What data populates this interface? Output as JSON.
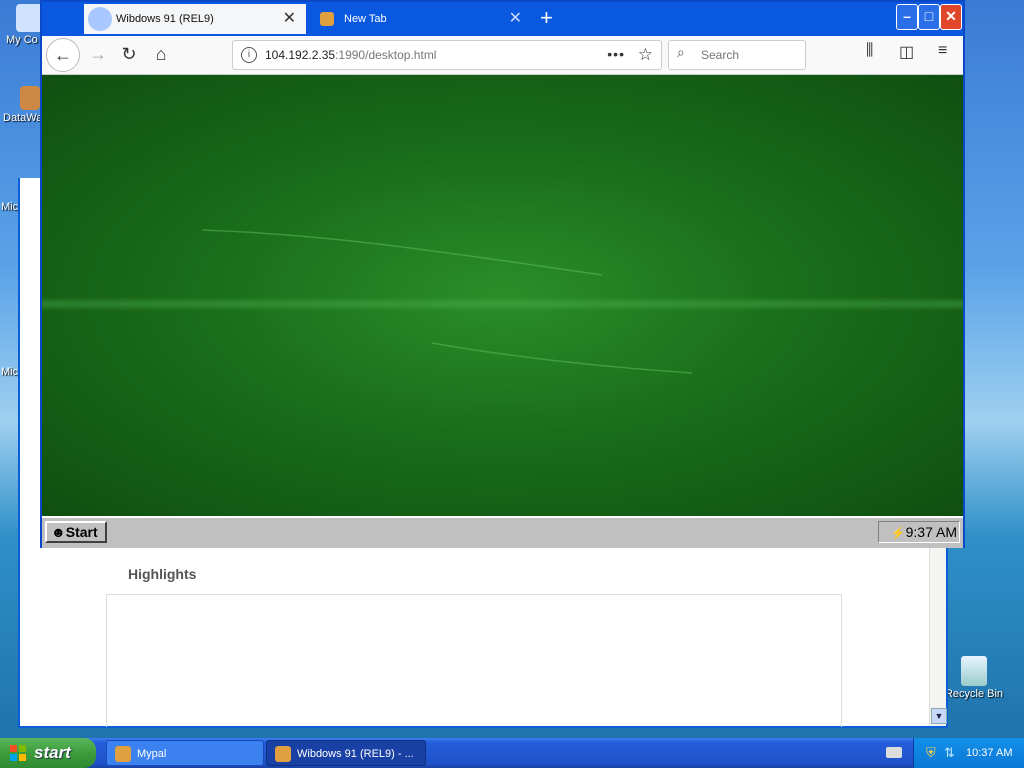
{
  "desktop": {
    "icons": [
      {
        "label": "My Co"
      },
      {
        "label": "DataWa"
      },
      {
        "label": "Mic"
      },
      {
        "label": "Mic"
      },
      {
        "label": "Recycle Bin"
      }
    ]
  },
  "background_window": {
    "section_title": "Highlights"
  },
  "browser": {
    "tabs": [
      {
        "label": "Wibdows 91 (REL9)",
        "active": true
      },
      {
        "label": "New Tab",
        "active": false
      }
    ],
    "url_host": "104.192.2.35",
    "url_rest": ":1990/desktop.html",
    "search_placeholder": "Search",
    "inner_os": {
      "start_label": "Start",
      "clock": "9:37 AM"
    }
  },
  "taskbar": {
    "start_label": "start",
    "items": [
      {
        "label": "Mypal"
      },
      {
        "label": "Wibdows 91 (REL9) - ..."
      }
    ],
    "clock": "10:37 AM"
  },
  "colors": {
    "xp_blue": "#245edb",
    "start_green": "#3c9d3c",
    "content_green": "#1a6e1a"
  }
}
